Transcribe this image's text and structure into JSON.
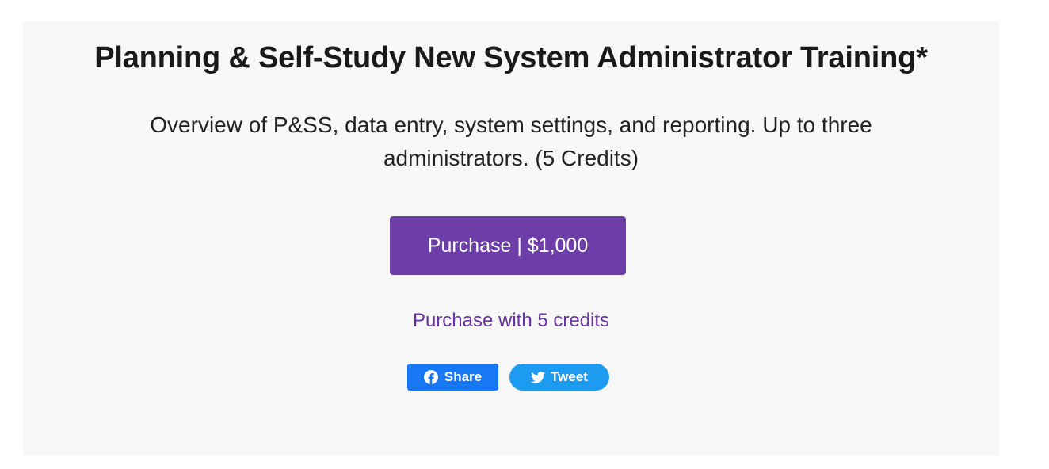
{
  "product": {
    "title": "Planning & Self-Study New System Administrator Training*",
    "description": "Overview of P&SS, data entry, system settings, and reporting. Up to three administrators. (5 Credits)",
    "purchase_button_label": "Purchase | $1,000",
    "credits_link_label": "Purchase with 5 credits"
  },
  "social": {
    "facebook_label": "Share",
    "facebook_icon": "facebook-icon",
    "twitter_label": "Tweet",
    "twitter_icon": "twitter-bird-icon"
  },
  "colors": {
    "card_background": "#f7f7f7",
    "purchase_button": "#6e3ea8",
    "credits_link": "#6633a0",
    "facebook": "#1877f2",
    "twitter": "#1d9bf0"
  }
}
